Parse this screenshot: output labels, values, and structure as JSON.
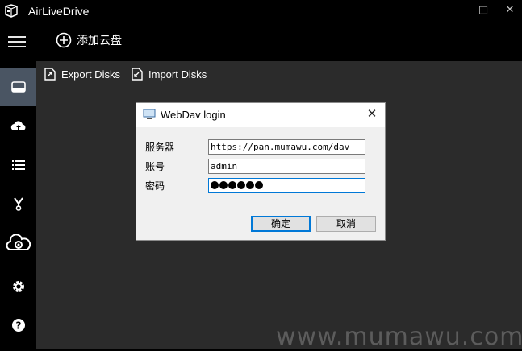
{
  "app": {
    "title": "AirLiveDrive"
  },
  "window_controls": {
    "minimize": "—",
    "maximize": "□",
    "close": "✕"
  },
  "toolbar": {
    "add_cloud_label": "添加云盘"
  },
  "sidebar": {
    "items": [
      {
        "icon": "drive-icon",
        "active": true
      },
      {
        "icon": "cloud-upload-icon"
      },
      {
        "icon": "list-icon"
      },
      {
        "icon": "y-branch-icon"
      },
      {
        "icon": "cloud-gear-icon"
      },
      {
        "icon": "gear-icon"
      },
      {
        "icon": "help-icon"
      }
    ]
  },
  "main": {
    "export_label": "Export Disks",
    "import_label": "Import Disks"
  },
  "dialog": {
    "title": "WebDav login",
    "server_label": "服务器",
    "server_value": "https://pan.mumawu.com/dav",
    "account_label": "账号",
    "account_value": "admin",
    "password_label": "密码",
    "password_masked_count": 6,
    "ok_label": "确定",
    "cancel_label": "取消"
  },
  "watermark": "www.mumawu.com"
}
